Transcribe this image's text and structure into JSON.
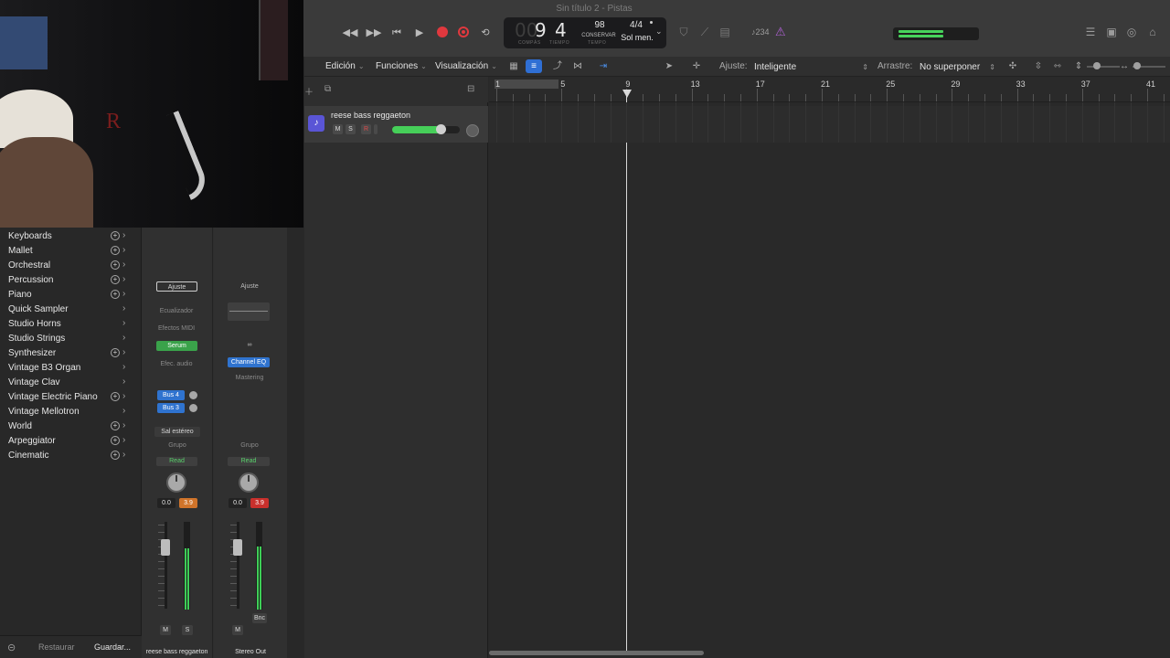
{
  "window": {
    "title": "Sin título 2 - Pistas"
  },
  "transport": {
    "rewind_icon": "rewind-icon",
    "forward_icon": "fast-forward-icon",
    "to_start_icon": "skip-to-start-icon",
    "play_icon": "play-icon",
    "record_icon": "record-icon",
    "capture_icon": "capture-record-icon",
    "cycle_icon": "cycle-icon"
  },
  "lcd": {
    "bars_faint": "00",
    "bar": "9",
    "beat": "4",
    "bars_label": "COMPÁS",
    "beat_label": "TIEMPO",
    "tempo": "98",
    "tempo_mode": "CONSERVAR",
    "tempo_label": "TEMPO",
    "time_signature": "4/4",
    "key": "Sol men."
  },
  "toolbar_right": {
    "cpu_label": "♪234",
    "master_meter_level": 0.6
  },
  "tracks_bar": {
    "menus": [
      "Edición",
      "Funciones",
      "Visualización"
    ],
    "snap_label": "Ajuste:",
    "snap_value": "Inteligente",
    "drag_label": "Arrastre:",
    "drag_value": "No superponer"
  },
  "track": {
    "name": "reese bass reggaeton",
    "mute": "M",
    "solo": "S",
    "record": "R",
    "volume": 0.75
  },
  "ruler": {
    "bars": [
      "1",
      "5",
      "9",
      "13",
      "17",
      "21",
      "25",
      "29",
      "33",
      "37",
      "41"
    ],
    "playhead_bar": 9
  },
  "library": {
    "items": [
      {
        "label": "Keyboards",
        "plus": true
      },
      {
        "label": "Mallet",
        "plus": true
      },
      {
        "label": "Orchestral",
        "plus": true
      },
      {
        "label": "Percussion",
        "plus": true
      },
      {
        "label": "Piano",
        "plus": true
      },
      {
        "label": "Quick Sampler",
        "plus": false
      },
      {
        "label": "Studio Horns",
        "plus": false
      },
      {
        "label": "Studio Strings",
        "plus": false
      },
      {
        "label": "Synthesizer",
        "plus": true
      },
      {
        "label": "Vintage B3 Organ",
        "plus": false
      },
      {
        "label": "Vintage Clav",
        "plus": false
      },
      {
        "label": "Vintage Electric Piano",
        "plus": true
      },
      {
        "label": "Vintage Mellotron",
        "plus": false
      },
      {
        "label": "World",
        "plus": true
      },
      {
        "label": "Arpeggiator",
        "plus": true
      },
      {
        "label": "Cinematic",
        "plus": true
      }
    ],
    "restore": "Restaurar",
    "save": "Guardar..."
  },
  "strip_a": {
    "setting": "Ajuste",
    "eq": "Ecualizador",
    "midi_fx": "Efectos MIDI",
    "instrument": "Serum",
    "audio_fx": "Efec. audio",
    "sends": [
      "Bus 4",
      "Bus 3"
    ],
    "output": "Sal estéreo",
    "group": "Grupo",
    "automation": "Read",
    "volume": "0.0",
    "peak": "3.9",
    "mute": "M",
    "solo": "S",
    "name": "reese bass reggaeton",
    "fader_position": 0.25,
    "meter_level": 0.7
  },
  "strip_b": {
    "setting": "Ajuste",
    "plugin": "Channel EQ",
    "plugin2": "Mastering",
    "group": "Grupo",
    "automation": "Read",
    "volume": "0.0",
    "peak": "3.9",
    "mute": "M",
    "bounce": "Bnc",
    "name": "Stereo Out",
    "fader_position": 0.25,
    "meter_level": 0.72
  },
  "colors": {
    "accent_blue": "#2f6fd4",
    "green": "#46cf59",
    "record_red": "#e0383e",
    "track_purple": "#5a55d6"
  }
}
